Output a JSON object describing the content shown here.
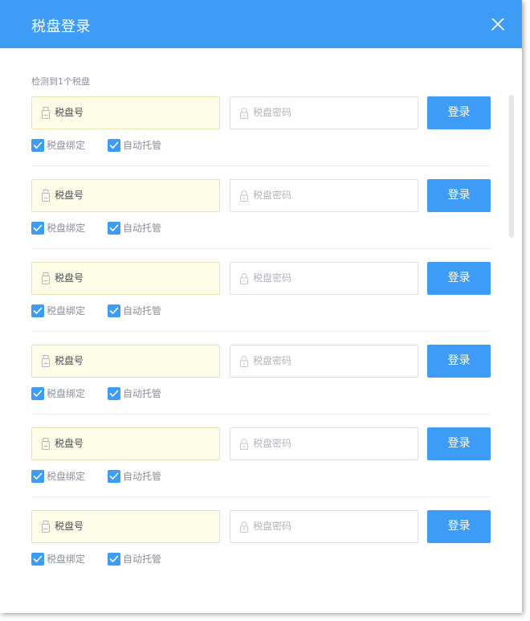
{
  "dialog": {
    "title": "税盘登录",
    "detect_label": "检测到1个税盘"
  },
  "colors": {
    "accent": "#3d9df6",
    "disk_field_bg": "#fdfde7"
  },
  "items": [
    {
      "disk_label": "税盘号",
      "password_placeholder": "税盘密码",
      "login_label": "登录",
      "bind_label": "税盘绑定",
      "bind_checked": true,
      "auto_label": "自动托管",
      "auto_checked": true
    },
    {
      "disk_label": "税盘号",
      "password_placeholder": "税盘密码",
      "login_label": "登录",
      "bind_label": "税盘绑定",
      "bind_checked": true,
      "auto_label": "自动托管",
      "auto_checked": true
    },
    {
      "disk_label": "税盘号",
      "password_placeholder": "税盘密码",
      "login_label": "登录",
      "bind_label": "税盘绑定",
      "bind_checked": true,
      "auto_label": "自动托管",
      "auto_checked": true
    },
    {
      "disk_label": "税盘号",
      "password_placeholder": "税盘密码",
      "login_label": "登录",
      "bind_label": "税盘绑定",
      "bind_checked": true,
      "auto_label": "自动托管",
      "auto_checked": true
    },
    {
      "disk_label": "税盘号",
      "password_placeholder": "税盘密码",
      "login_label": "登录",
      "bind_label": "税盘绑定",
      "bind_checked": true,
      "auto_label": "自动托管",
      "auto_checked": true
    },
    {
      "disk_label": "税盘号",
      "password_placeholder": "税盘密码",
      "login_label": "登录",
      "bind_label": "税盘绑定",
      "bind_checked": true,
      "auto_label": "自动托管",
      "auto_checked": true
    }
  ]
}
